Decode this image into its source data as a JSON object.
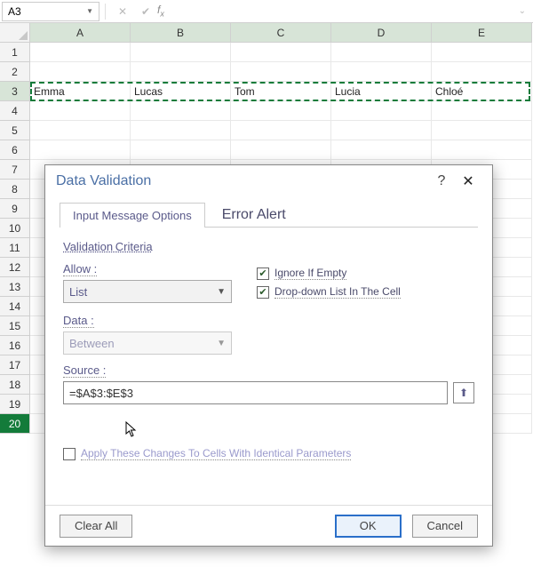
{
  "name_box": "A3",
  "fx_symbol": "fx",
  "columns": [
    "A",
    "B",
    "C",
    "D",
    "E"
  ],
  "row_count": 20,
  "selected_row": 3,
  "active_row_header": 20,
  "row3": [
    "Emma",
    "Lucas",
    "Tom",
    "Lucia",
    "Chloé"
  ],
  "dialog": {
    "title": "Data Validation",
    "help": "?",
    "close": "✕",
    "tabs": {
      "t1": "Input Message Options",
      "t2": "Error Alert"
    },
    "criteria_label": "Validation Criteria",
    "allow_label": "Allow :",
    "allow_value": "List",
    "data_label": "Data :",
    "data_value": "Between",
    "chk_ignore": "Ignore If Empty",
    "chk_dropdown": "Drop-down List In The Cell",
    "source_label": "Source :",
    "source_value": "=$A$3:$E$3",
    "pick_icon": "⬆",
    "apply_label": "Apply These Changes To Cells With Identical Parameters",
    "clear": "Clear All",
    "ok": "OK",
    "cancel": "Cancel"
  }
}
